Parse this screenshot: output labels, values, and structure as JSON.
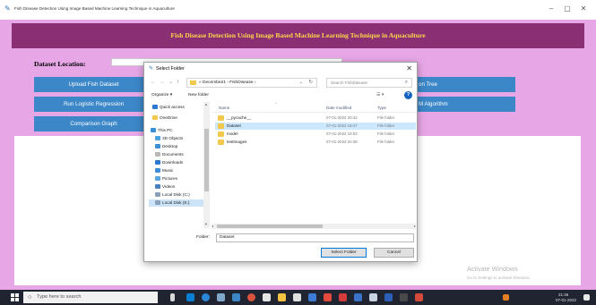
{
  "window": {
    "title": "Fish Disease Detection Using Image Based Machine Learning Technique in Aquaculture",
    "minimize": "–",
    "maximize": "▢",
    "close": "✕"
  },
  "app": {
    "heading": "Fish Disease Detection Using Image Based Machine Learning Technique in Aquaculture",
    "dataset_location_label": "Dataset Location:",
    "buttons": {
      "upload": "Upload Fish Dataset",
      "logistic": "Run Logistic Regression",
      "comparison": "Comparison Graph",
      "tree": "on Tree",
      "svm": "M Algorithm"
    }
  },
  "dialog": {
    "title": "Select Folder",
    "close": "✕",
    "nav": {
      "back": "←",
      "forward": "→",
      "recent": "⌄",
      "up": "↑"
    },
    "breadcrumb": "« Decembe21 › FishDisease ›",
    "breadcrumb_dropdown": "⌄",
    "refresh": "↻",
    "search_placeholder": "Search FishDisease",
    "search_icon": "⌕",
    "toolbar": {
      "organize": "Organize ▾",
      "new_folder": "New folder",
      "view": "☰ ▾",
      "help": "?"
    },
    "nav_pane": [
      {
        "label": "Quick access",
        "icon": "star-icon",
        "color": "#2b78d0"
      },
      {
        "label": "OneDrive",
        "icon": "cloud-icon",
        "color": "#f2c94c"
      },
      {
        "label": "This PC",
        "icon": "computer-icon",
        "color": "#3a8fd8"
      },
      {
        "label": "3D Objects",
        "icon": "cube-icon",
        "color": "#4aa3df"
      },
      {
        "label": "Desktop",
        "icon": "desktop-icon",
        "color": "#3a8fd8"
      },
      {
        "label": "Documents",
        "icon": "document-icon",
        "color": "#b8b8b8"
      },
      {
        "label": "Downloads",
        "icon": "download-icon",
        "color": "#2b78d0"
      },
      {
        "label": "Music",
        "icon": "music-icon",
        "color": "#3a8fd8"
      },
      {
        "label": "Pictures",
        "icon": "picture-icon",
        "color": "#5aa7e0"
      },
      {
        "label": "Videos",
        "icon": "video-icon",
        "color": "#4a7fc0"
      },
      {
        "label": "Local Disk (C:)",
        "icon": "drive-icon",
        "color": "#8aa0b8"
      },
      {
        "label": "Local Disk (E:)",
        "icon": "drive-icon",
        "color": "#8aa0b8"
      }
    ],
    "columns": {
      "name": "Name",
      "date": "Date modified",
      "type": "Type"
    },
    "files": [
      {
        "name": "__pycache__",
        "date": "07-01-2022 20:42",
        "type": "File folder"
      },
      {
        "name": "Dataset",
        "date": "07-01-2022 19:47",
        "type": "File folder"
      },
      {
        "name": "model",
        "date": "07-01-2022 19:02",
        "type": "File folder"
      },
      {
        "name": "testImages",
        "date": "07-01-2022 20:38",
        "type": "File folder"
      }
    ],
    "folder_label": "Folder:",
    "folder_value": "Dataset",
    "select_button": "Select Folder",
    "cancel_button": "Cancel"
  },
  "watermark": {
    "title": "Activate Windows",
    "subtitle": "Go to Settings to activate Windows."
  },
  "taskbar": {
    "search_placeholder": "Type here to search",
    "time": "21:46",
    "date": "07-01-2022"
  }
}
